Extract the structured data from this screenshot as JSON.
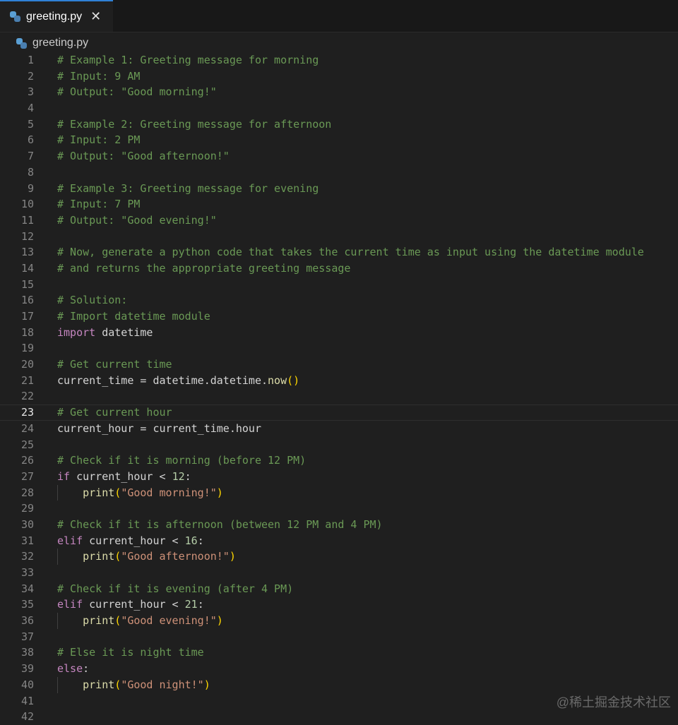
{
  "tab": {
    "filename": "greeting.py",
    "icon": "python-icon",
    "close_icon": "close-icon"
  },
  "breadcrumb": {
    "filename": "greeting.py"
  },
  "editor": {
    "current_line": 23,
    "indent_guide_lines": [
      28,
      32,
      36,
      40
    ],
    "lines": [
      [
        [
          "cm",
          "# Example 1: Greeting message for morning"
        ]
      ],
      [
        [
          "cm",
          "# Input: 9 AM"
        ]
      ],
      [
        [
          "cm",
          "# Output: \"Good morning!\""
        ]
      ],
      [],
      [
        [
          "cm",
          "# Example 2: Greeting message for afternoon"
        ]
      ],
      [
        [
          "cm",
          "# Input: 2 PM"
        ]
      ],
      [
        [
          "cm",
          "# Output: \"Good afternoon!\""
        ]
      ],
      [],
      [
        [
          "cm",
          "# Example 3: Greeting message for evening"
        ]
      ],
      [
        [
          "cm",
          "# Input: 7 PM"
        ]
      ],
      [
        [
          "cm",
          "# Output: \"Good evening!\""
        ]
      ],
      [],
      [
        [
          "cm",
          "# Now, generate a python code that takes the current time as input using the datetime module"
        ]
      ],
      [
        [
          "cm",
          "# and returns the appropriate greeting message"
        ]
      ],
      [],
      [
        [
          "cm",
          "# Solution:"
        ]
      ],
      [
        [
          "cm",
          "# Import datetime module"
        ]
      ],
      [
        [
          "kw",
          "import"
        ],
        [
          "tx",
          " datetime"
        ]
      ],
      [],
      [
        [
          "cm",
          "# Get current time"
        ]
      ],
      [
        [
          "tx",
          "current_time = datetime.datetime."
        ],
        [
          "fn",
          "now"
        ],
        [
          "pa",
          "()"
        ]
      ],
      [],
      [
        [
          "cm",
          "# Get current hour"
        ]
      ],
      [
        [
          "tx",
          "current_hour = current_time.hour"
        ]
      ],
      [],
      [
        [
          "cm",
          "# Check if it is morning (before 12 PM)"
        ]
      ],
      [
        [
          "kw",
          "if"
        ],
        [
          "tx",
          " current_hour < "
        ],
        [
          "nu",
          "12"
        ],
        [
          "tx",
          ":"
        ]
      ],
      [
        [
          "tx",
          "    "
        ],
        [
          "fn",
          "print"
        ],
        [
          "pa",
          "("
        ],
        [
          "st",
          "\"Good morning!\""
        ],
        [
          "pa",
          ")"
        ]
      ],
      [],
      [
        [
          "cm",
          "# Check if it is afternoon (between 12 PM and 4 PM)"
        ]
      ],
      [
        [
          "kw",
          "elif"
        ],
        [
          "tx",
          " current_hour < "
        ],
        [
          "nu",
          "16"
        ],
        [
          "tx",
          ":"
        ]
      ],
      [
        [
          "tx",
          "    "
        ],
        [
          "fn",
          "print"
        ],
        [
          "pa",
          "("
        ],
        [
          "st",
          "\"Good afternoon!\""
        ],
        [
          "pa",
          ")"
        ]
      ],
      [],
      [
        [
          "cm",
          "# Check if it is evening (after 4 PM)"
        ]
      ],
      [
        [
          "kw",
          "elif"
        ],
        [
          "tx",
          " current_hour < "
        ],
        [
          "nu",
          "21"
        ],
        [
          "tx",
          ":"
        ]
      ],
      [
        [
          "tx",
          "    "
        ],
        [
          "fn",
          "print"
        ],
        [
          "pa",
          "("
        ],
        [
          "st",
          "\"Good evening!\""
        ],
        [
          "pa",
          ")"
        ]
      ],
      [],
      [
        [
          "cm",
          "# Else it is night time"
        ]
      ],
      [
        [
          "kw",
          "else"
        ],
        [
          "tx",
          ":"
        ]
      ],
      [
        [
          "tx",
          "    "
        ],
        [
          "fn",
          "print"
        ],
        [
          "pa",
          "("
        ],
        [
          "st",
          "\"Good night!\""
        ],
        [
          "pa",
          ")"
        ]
      ],
      [],
      []
    ]
  },
  "watermark": "@稀土掘金技术社区"
}
